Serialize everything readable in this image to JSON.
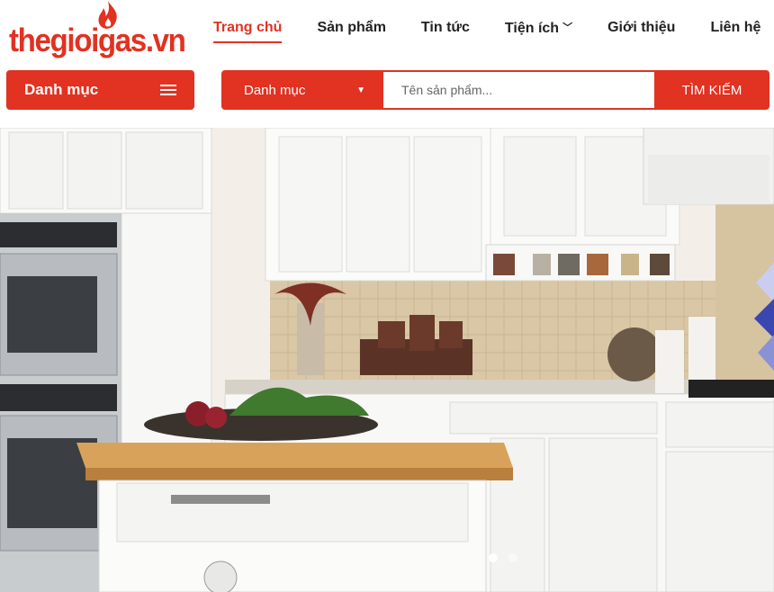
{
  "brand": {
    "logo_text": "thegioigas.vn",
    "accent": "#e13222"
  },
  "nav": {
    "items": [
      {
        "label": "Trang chủ",
        "active": true
      },
      {
        "label": "Sản phẩm"
      },
      {
        "label": "Tin tức"
      },
      {
        "label": "Tiện ích",
        "icon": "chevron-down-icon"
      },
      {
        "label": "Giới thiệu"
      },
      {
        "label": "Liên hệ"
      }
    ]
  },
  "category_button": {
    "label": "Danh mục",
    "icon": "menu-icon"
  },
  "search": {
    "category_select": "Danh mục",
    "placeholder": "Tên sản phẩm...",
    "button_label": "TÌM KIẾM"
  },
  "hero": {
    "image": "kitchen-photo",
    "slides": 2,
    "active_slide": 1
  }
}
